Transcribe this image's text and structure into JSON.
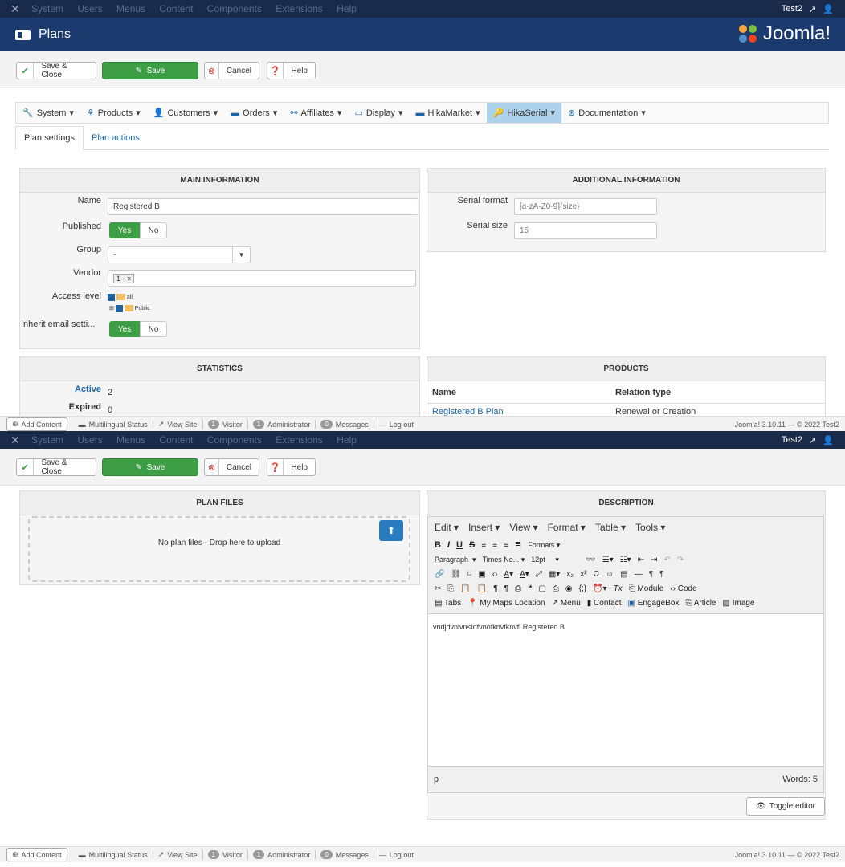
{
  "topbar": {
    "menu": [
      "System",
      "Users",
      "Menus",
      "Content",
      "Components",
      "Extensions",
      "Help"
    ],
    "user": "Test2"
  },
  "header": {
    "title": "Plans",
    "brand": "Joomla!"
  },
  "toolbar": {
    "save_close": "Save & Close",
    "save": "Save",
    "cancel": "Cancel",
    "help": "Help"
  },
  "navtabs": [
    "System",
    "Products",
    "Customers",
    "Orders",
    "Affiliates",
    "Display",
    "HikaMarket",
    "HikaSerial",
    "Documentation"
  ],
  "subtabs": {
    "settings": "Plan settings",
    "actions": "Plan actions"
  },
  "main_info": {
    "heading": "MAIN INFORMATION",
    "name_label": "Name",
    "name_value": "Registered B",
    "published_label": "Published",
    "group_label": "Group",
    "group_value": "-",
    "vendor_label": "Vendor",
    "vendor_value": "1 - ×",
    "access_label": "Access level",
    "access_all": "all",
    "access_public": "Public",
    "inherit_label": "Inherit email setti...",
    "yes": "Yes",
    "no": "No"
  },
  "additional_info": {
    "heading": "ADDITIONAL INFORMATION",
    "format_label": "Serial format",
    "format_placeholder": "[a-zA-Z0-9]{size}",
    "size_label": "Serial size",
    "size_placeholder": "15"
  },
  "statistics": {
    "heading": "STATISTICS",
    "active_label": "Active",
    "active_value": "2",
    "expired_label": "Expired",
    "expired_value": "0"
  },
  "products": {
    "heading": "PRODUCTS",
    "col_name": "Name",
    "col_relation": "Relation type",
    "row_name": "Registered B Plan",
    "row_relation": "Renewal or Creation"
  },
  "statusbar": {
    "add_content": "Add Content",
    "multilingual": "Multilingual Status",
    "view_site": "View Site",
    "visitor_count": "1",
    "visitor": "Visitor",
    "admin_count": "1",
    "admin": "Administrator",
    "messages_count": "0",
    "messages": "Messages",
    "logout": "Log out",
    "version": "Joomla! 3.10.11 — © 2022 Test2"
  },
  "plan_files": {
    "heading": "PLAN FILES",
    "empty": "No plan files - Drop here to upload"
  },
  "description": {
    "heading": "DESCRIPTION",
    "menu": [
      "Edit ▾",
      "Insert ▾",
      "View ▾",
      "Format ▾",
      "Table ▾",
      "Tools ▾"
    ],
    "formats": "Formats ▾",
    "paragraph": "Paragraph",
    "font": "Times Ne...",
    "size": "12pt",
    "module": "Module",
    "code": "Code",
    "tabs": "Tabs",
    "maps": "My Maps Location",
    "menu_btn": "Menu",
    "contact": "Contact",
    "engagebox": "EngageBox",
    "article": "Article",
    "image": "Image",
    "content": "vndjdvnlvn<ldfvnòfknvfknvfl Registered B",
    "path": "p",
    "words": "Words: 5",
    "toggle": "Toggle editor"
  }
}
